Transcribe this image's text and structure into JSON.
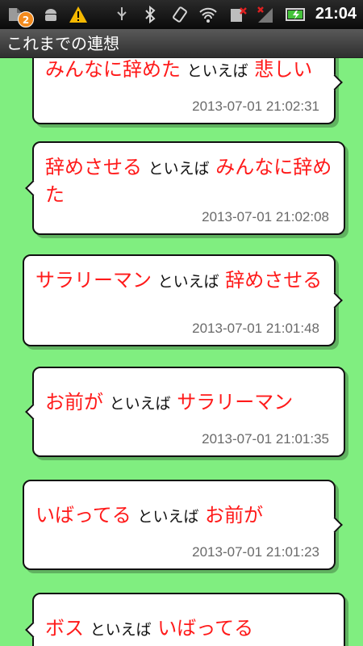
{
  "status_bar": {
    "notification_count": "2",
    "clock": "21:04",
    "icons": [
      "app-notification-icon",
      "android-debug-icon",
      "warning-icon",
      "usb-icon",
      "bluetooth-icon",
      "rotation-icon",
      "wifi-icon",
      "no-sim-icon",
      "signal-icon",
      "battery-charging-icon"
    ]
  },
  "title_bar": {
    "title": "これまでの連想"
  },
  "colors": {
    "background": "#80ee80",
    "word": "#ff1a1a",
    "link": "#111111",
    "timestamp": "#6a6a6a"
  },
  "entries": [
    {
      "word": "みんなに辞めた",
      "link": "といえば",
      "next": "悲しい",
      "timestamp": "2013-07-01 21:02:31"
    },
    {
      "word": "辞めさせる",
      "link": "といえば",
      "next": "みんなに辞めた",
      "timestamp": "2013-07-01 21:02:08"
    },
    {
      "word": "サラリーマン",
      "link": "といえば",
      "next": "辞めさせる",
      "timestamp": "2013-07-01 21:01:48"
    },
    {
      "word": "お前が",
      "link": "といえば",
      "next": "サラリーマン",
      "timestamp": "2013-07-01 21:01:35"
    },
    {
      "word": "いばってる",
      "link": "といえば",
      "next": "お前が",
      "timestamp": "2013-07-01 21:01:23"
    },
    {
      "word": "ボス",
      "link": "といえば",
      "next": "いばってる",
      "timestamp": ""
    }
  ]
}
